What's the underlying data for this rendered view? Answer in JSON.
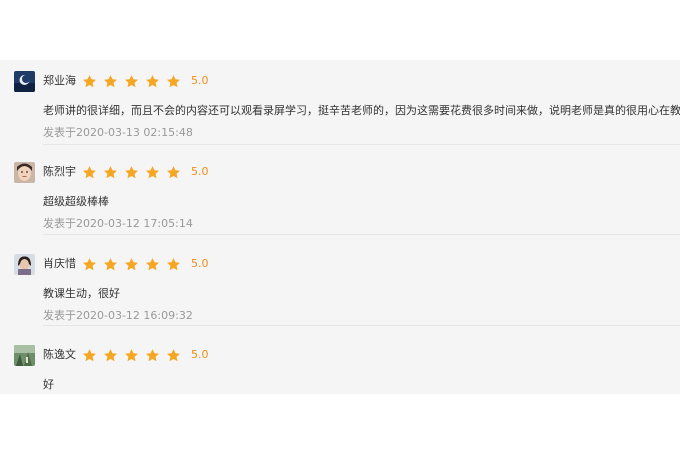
{
  "reviews": [
    {
      "user": "郑业海",
      "rating": 5,
      "score": "5.0",
      "content": "老师讲的很详细，而且不会的内容还可以观看录屏学习，挺辛苦老师的，因为这需要花费很多时间来做，说明老师是真的很用心在教学",
      "time": "发表于2020-03-13 02:15:48"
    },
    {
      "user": "陈烈宇",
      "rating": 5,
      "score": "5.0",
      "content": "超级超级棒棒",
      "time": "发表于2020-03-12 17:05:14"
    },
    {
      "user": "肖庆惜",
      "rating": 5,
      "score": "5.0",
      "content": "教课生动，很好",
      "time": "发表于2020-03-12 16:09:32"
    },
    {
      "user": "陈逸文",
      "rating": 5,
      "score": "5.0",
      "content": "好",
      "time": ""
    }
  ],
  "colors": {
    "star": "#f5a623",
    "score": "#f08c1c",
    "panel_bg": "#f5f5f5"
  },
  "icons": {
    "star": "star-icon",
    "avatar": "avatar"
  }
}
